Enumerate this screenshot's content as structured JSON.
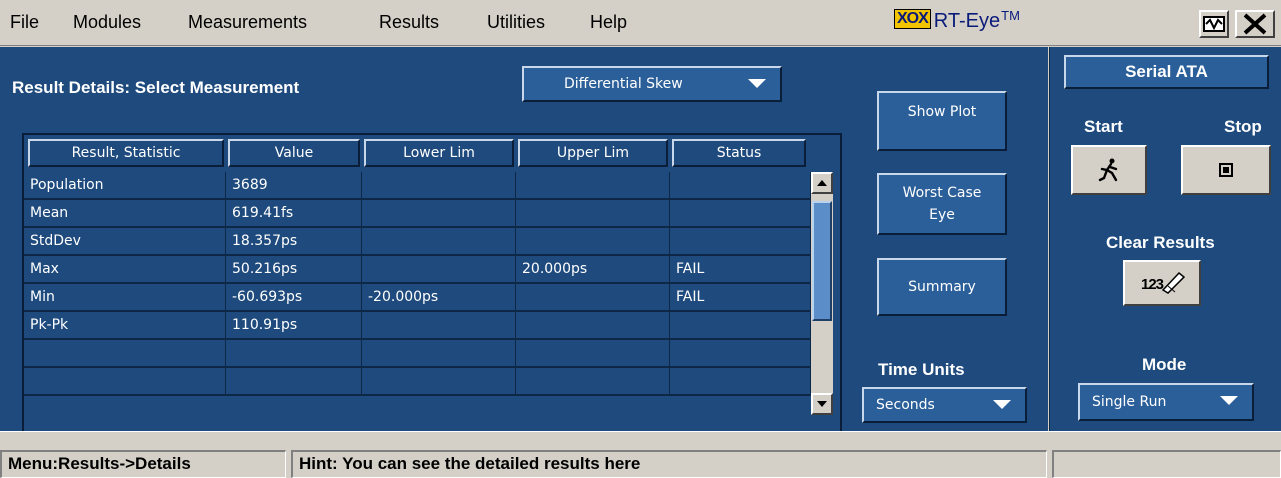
{
  "menu": {
    "items": [
      "File",
      "Modules",
      "Measurements",
      "Results",
      "Utilities",
      "Help"
    ]
  },
  "app": {
    "logo_badge": "XOX",
    "title": "RT-Eye",
    "trademark": "TM"
  },
  "results": {
    "title": "Result Details: Select Measurement",
    "measurement": "Differential Skew",
    "columns": [
      "Result, Statistic",
      "Value",
      "Lower Lim",
      "Upper Lim",
      "Status"
    ],
    "rows": [
      [
        "Population",
        "3689",
        "",
        "",
        ""
      ],
      [
        "Mean",
        "619.41fs",
        "",
        "",
        ""
      ],
      [
        "StdDev",
        "18.357ps",
        "",
        "",
        ""
      ],
      [
        "Max",
        "50.216ps",
        "",
        "20.000ps",
        "FAIL"
      ],
      [
        "Min",
        "-60.693ps",
        "-20.000ps",
        "",
        "FAIL"
      ],
      [
        "Pk-Pk",
        "110.91ps",
        "",
        "",
        ""
      ],
      [
        "",
        "",
        "",
        "",
        ""
      ],
      [
        "",
        "",
        "",
        "",
        ""
      ]
    ]
  },
  "actions": {
    "show_plot": "Show Plot",
    "worst_case_eye_line1": "Worst Case",
    "worst_case_eye_line2": "Eye",
    "summary": "Summary",
    "time_units_label": "Time Units",
    "time_units_value": "Seconds"
  },
  "side": {
    "standard": "Serial ATA",
    "start_label": "Start",
    "stop_label": "Stop",
    "clear_results_label": "Clear Results",
    "clear_icon_text": "123",
    "mode_label": "Mode",
    "mode_value": "Single Run"
  },
  "status": {
    "menu_path": "Menu:Results->Details",
    "hint": "Hint: You can see the detailed results here"
  },
  "colors": {
    "panel": "#1e4a7d",
    "chrome": "#d4d0c8",
    "logo_yellow": "#f2c400"
  }
}
